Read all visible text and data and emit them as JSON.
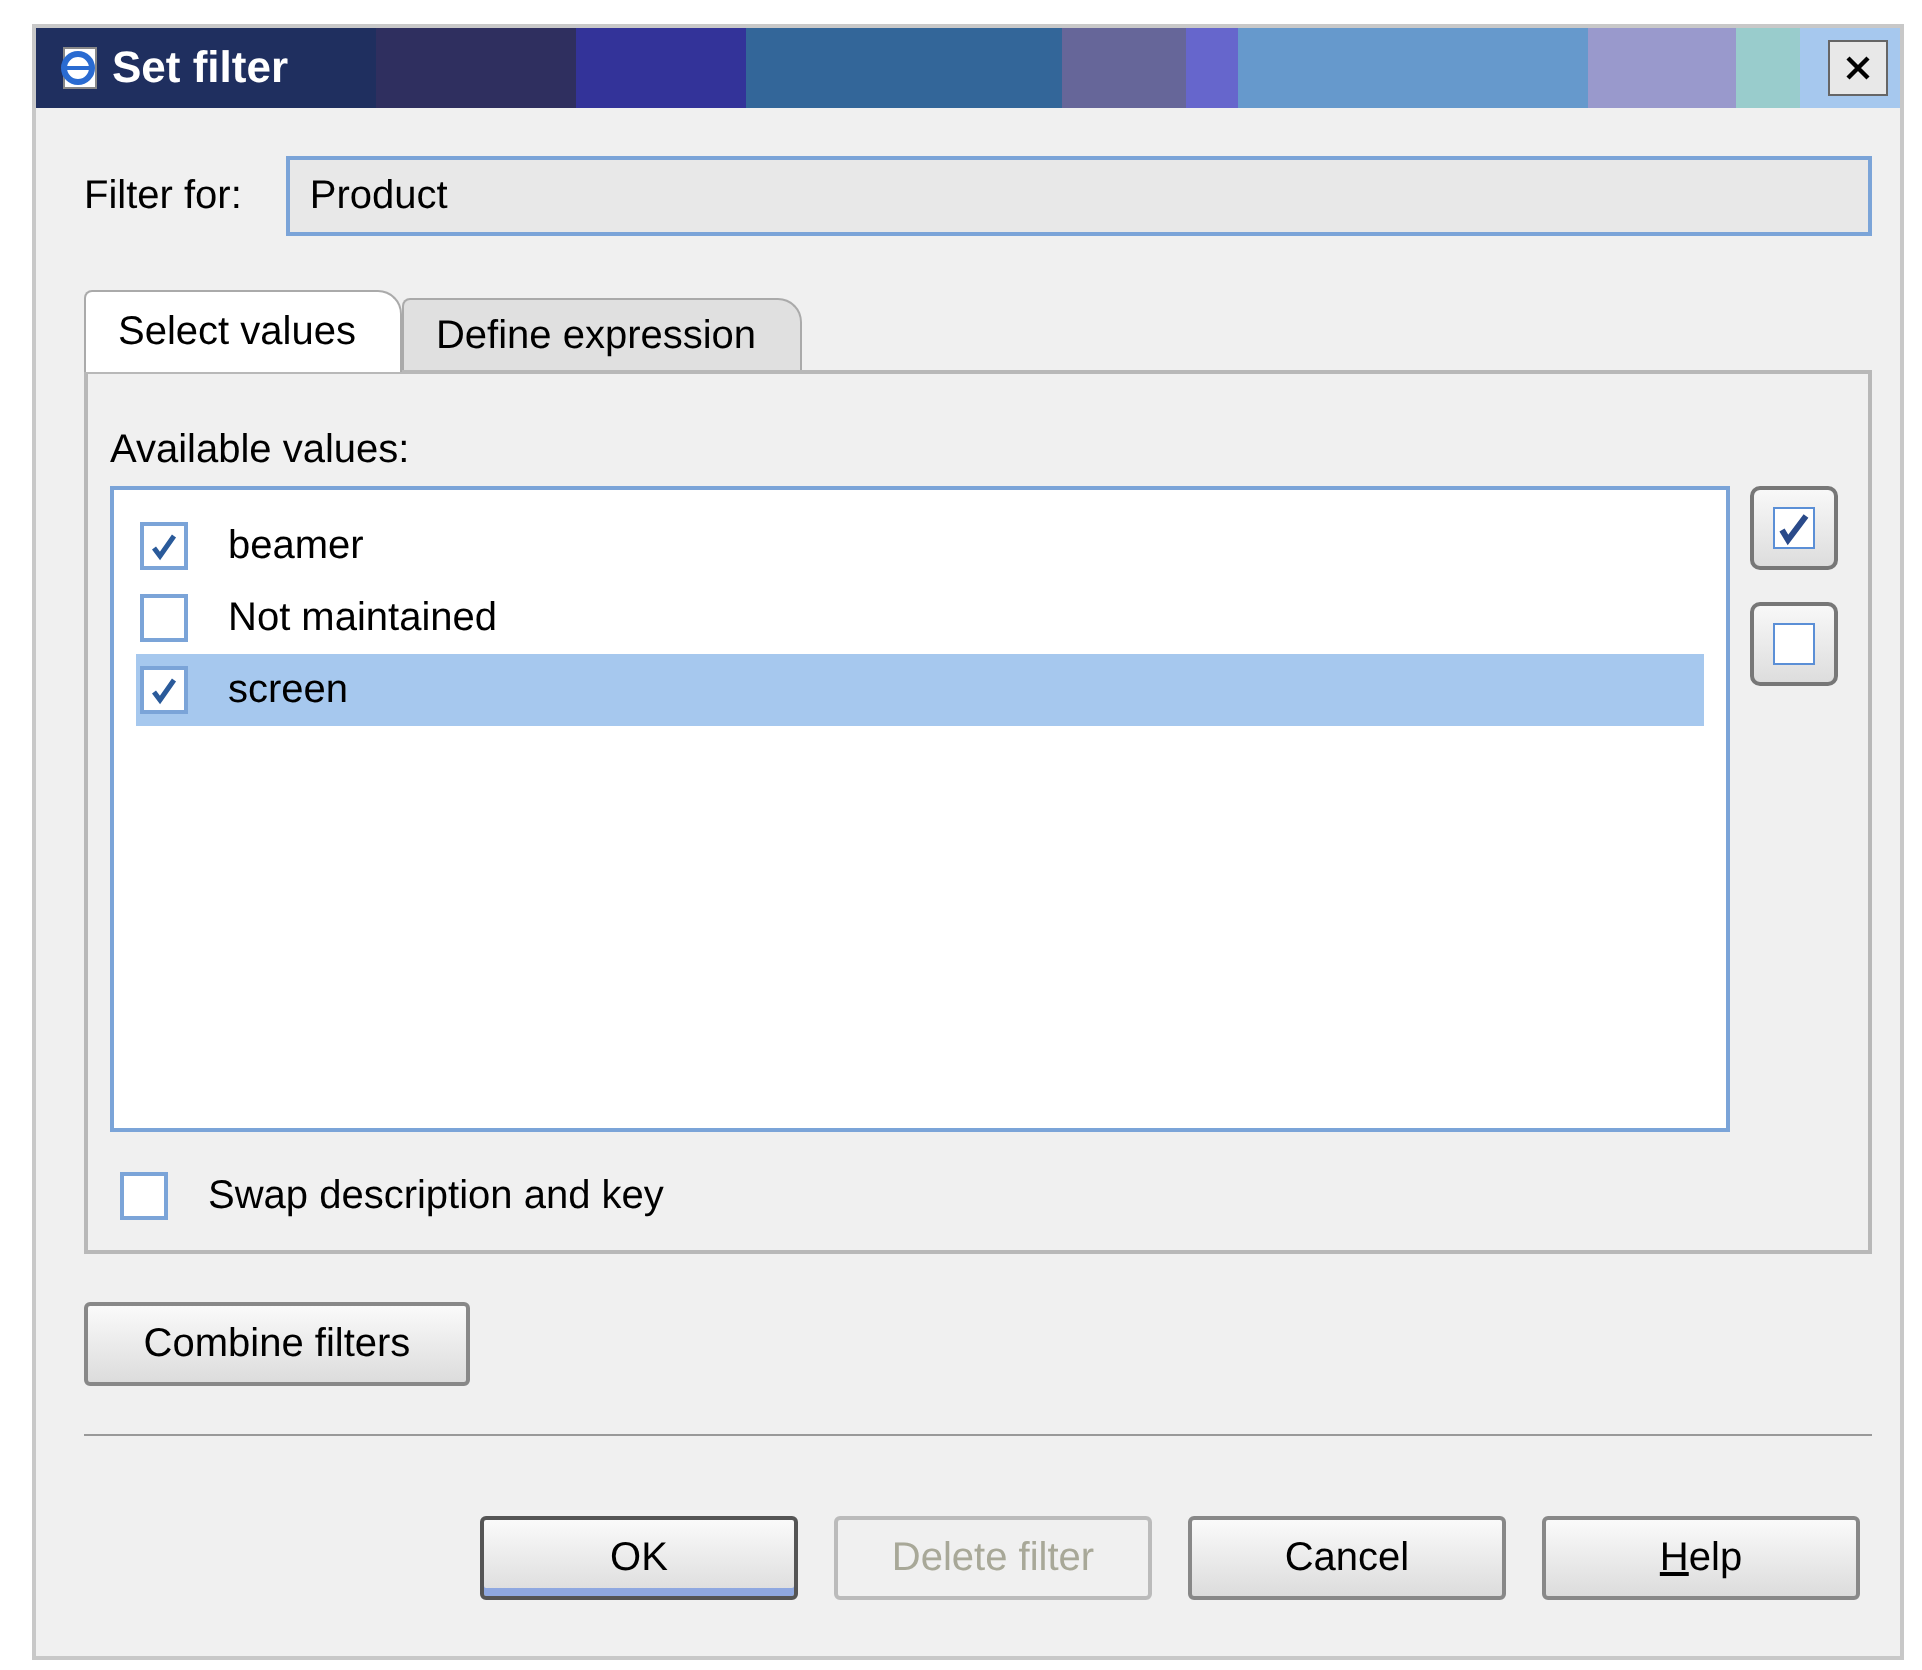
{
  "window": {
    "title": "Set filter"
  },
  "filter_for": {
    "label": "Filter for:",
    "value": "Product"
  },
  "tabs": [
    {
      "label": "Select values",
      "selected": true
    },
    {
      "label": "Define expression",
      "selected": false
    }
  ],
  "available_values": {
    "label": "Available values:",
    "items": [
      {
        "label": "beamer",
        "checked": true,
        "selected": false
      },
      {
        "label": "Not maintained",
        "checked": false,
        "selected": false
      },
      {
        "label": "screen",
        "checked": true,
        "selected": true
      }
    ]
  },
  "swap": {
    "label": "Swap description and key",
    "checked": false
  },
  "combine_button": "Combine filters",
  "buttons": [
    {
      "label": "OK",
      "kind": "default",
      "disabled": false,
      "mnemonic": false
    },
    {
      "label": "Delete filter",
      "kind": "normal",
      "disabled": true,
      "mnemonic": false
    },
    {
      "label": "Cancel",
      "kind": "normal",
      "disabled": false,
      "mnemonic": false
    },
    {
      "label": "Help",
      "kind": "normal",
      "disabled": false,
      "mnemonic": true
    }
  ]
}
